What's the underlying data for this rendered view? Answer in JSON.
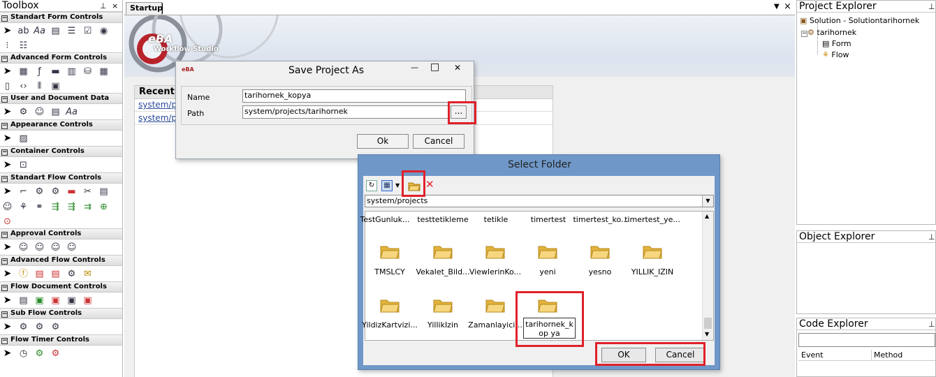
{
  "toolbox": {
    "title": "Toolbox",
    "pin": "p",
    "close": "×",
    "sections": [
      {
        "label": "Standart Form Controls"
      },
      {
        "label": "Advanced Form Controls"
      },
      {
        "label": "User and Document Data"
      },
      {
        "label": "Appearance Controls"
      },
      {
        "label": "Container Controls"
      },
      {
        "label": "Standart Flow Controls"
      },
      {
        "label": "Approval Controls"
      },
      {
        "label": "Advanced Flow Controls"
      },
      {
        "label": "Flow Document Controls"
      },
      {
        "label": "Sub Flow Controls"
      },
      {
        "label": "Flow Timer Controls"
      }
    ],
    "minus": "−"
  },
  "tabs": {
    "startup": "Startup"
  },
  "logo": {
    "brand": "eBA",
    "product": "Workflow Studio"
  },
  "recent": {
    "heading": "Recent",
    "links": [
      "system/p",
      "system/p"
    ]
  },
  "project_explorer": {
    "title": "Project Explorer",
    "items": [
      "Solution - Solutiontarihornek",
      "tarihornek",
      "Form",
      "Flow"
    ],
    "expander": "−"
  },
  "object_explorer": {
    "title": "Object Explorer"
  },
  "code_explorer": {
    "title": "Code Explorer",
    "columns": [
      "Event",
      "Method"
    ]
  },
  "save_dialog": {
    "title": "Save Project As",
    "name_label": "Name",
    "name_value": "tarihornek_kopya",
    "path_label": "Path",
    "path_value": "system/projects/tarihornek",
    "browse_label": "...",
    "ok_label": "Ok",
    "cancel_label": "Cancel",
    "minimize": "—",
    "maximize": "□",
    "close": "✕"
  },
  "folder_dialog": {
    "title": "Select Folder",
    "path_value": "system/projects",
    "top_row": [
      "TestGunluk...",
      "testtetikleme",
      "tetikle",
      "timertest",
      "timertest_ko...",
      "timertest_ye..."
    ],
    "mid_row": [
      "TMSLCY",
      "Vekalet_Bild...",
      "ViewlerinKo...",
      "yeni",
      "yesno",
      "YILLIK_IZIN"
    ],
    "bottom_row": [
      "YildizKartvizi...",
      "YillikIzin",
      "Zamanlayici...",
      "tarihornek_kop ya"
    ],
    "ok_label": "OK",
    "cancel_label": "Cancel",
    "delete_icon_glyph": "✕",
    "dropdown_glyph": "▼"
  },
  "colors": {
    "highlight": "#e0202a",
    "folder": "#f2c94c",
    "dialog_title_bg": "#6f98c8"
  }
}
